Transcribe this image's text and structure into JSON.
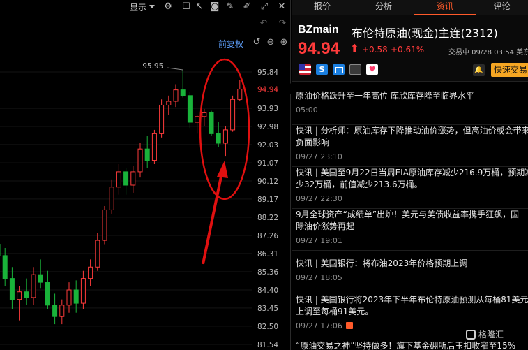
{
  "toolbar": {
    "display_label": "显示",
    "icons": [
      "settings-icon",
      "square-icon",
      "cursor-icon",
      "camera-icon",
      "brush-icon",
      "pencil-icon",
      "fullscreen-icon",
      "close-icon"
    ]
  },
  "chart": {
    "restore_label": "前复权",
    "current_price_label": "94.94",
    "high_annotation": "95.95"
  },
  "chart_data": {
    "type": "candlestick",
    "y_ticks": [
      "95.84",
      "94.94",
      "93.93",
      "92.98",
      "92.03",
      "91.07",
      "90.12",
      "89.17",
      "88.22",
      "87.26",
      "86.31",
      "85.36",
      "84.40",
      "83.45",
      "82.50",
      "81.54"
    ],
    "current_price": 94.94,
    "high_annotation": 95.95,
    "candles": [
      {
        "o": 86.8,
        "h": 87.6,
        "l": 86.0,
        "c": 86.2
      },
      {
        "o": 86.2,
        "h": 86.6,
        "l": 84.6,
        "c": 85.0
      },
      {
        "o": 85.0,
        "h": 85.6,
        "l": 83.4,
        "c": 83.9
      },
      {
        "o": 83.9,
        "h": 84.6,
        "l": 82.8,
        "c": 84.3
      },
      {
        "o": 84.3,
        "h": 85.0,
        "l": 83.6,
        "c": 84.0
      },
      {
        "o": 84.0,
        "h": 85.6,
        "l": 83.6,
        "c": 85.2
      },
      {
        "o": 85.2,
        "h": 86.0,
        "l": 84.5,
        "c": 84.8
      },
      {
        "o": 84.8,
        "h": 85.4,
        "l": 83.4,
        "c": 83.6
      },
      {
        "o": 83.6,
        "h": 84.2,
        "l": 82.6,
        "c": 83.0
      },
      {
        "o": 83.0,
        "h": 83.9,
        "l": 82.6,
        "c": 83.6
      },
      {
        "o": 83.6,
        "h": 84.8,
        "l": 83.2,
        "c": 84.4
      },
      {
        "o": 84.4,
        "h": 84.9,
        "l": 83.2,
        "c": 83.7
      },
      {
        "o": 83.7,
        "h": 85.4,
        "l": 83.4,
        "c": 85.0
      },
      {
        "o": 85.0,
        "h": 86.0,
        "l": 84.6,
        "c": 85.6
      },
      {
        "o": 85.6,
        "h": 87.4,
        "l": 85.4,
        "c": 87.0
      },
      {
        "o": 87.0,
        "h": 88.8,
        "l": 86.8,
        "c": 88.6
      },
      {
        "o": 88.6,
        "h": 90.2,
        "l": 88.4,
        "c": 89.8
      },
      {
        "o": 89.8,
        "h": 91.0,
        "l": 89.4,
        "c": 90.6
      },
      {
        "o": 90.6,
        "h": 90.8,
        "l": 89.4,
        "c": 89.9
      },
      {
        "o": 89.9,
        "h": 90.9,
        "l": 89.5,
        "c": 90.6
      },
      {
        "o": 90.6,
        "h": 92.1,
        "l": 90.3,
        "c": 91.8
      },
      {
        "o": 91.8,
        "h": 92.5,
        "l": 90.8,
        "c": 91.2
      },
      {
        "o": 91.2,
        "h": 92.8,
        "l": 91.0,
        "c": 92.6
      },
      {
        "o": 92.6,
        "h": 94.4,
        "l": 92.4,
        "c": 94.1
      },
      {
        "o": 94.1,
        "h": 94.6,
        "l": 93.6,
        "c": 94.3
      },
      {
        "o": 94.3,
        "h": 95.2,
        "l": 94.0,
        "c": 94.9
      },
      {
        "o": 94.9,
        "h": 95.95,
        "l": 94.5,
        "c": 94.6
      },
      {
        "o": 94.6,
        "h": 94.8,
        "l": 92.9,
        "c": 93.2
      },
      {
        "o": 93.2,
        "h": 93.6,
        "l": 92.6,
        "c": 93.5
      },
      {
        "o": 93.5,
        "h": 93.9,
        "l": 93.0,
        "c": 93.7
      },
      {
        "o": 93.7,
        "h": 93.8,
        "l": 92.5,
        "c": 92.6
      },
      {
        "o": 92.6,
        "h": 93.2,
        "l": 91.9,
        "c": 92.1
      },
      {
        "o": 92.1,
        "h": 93.0,
        "l": 91.4,
        "c": 92.8
      },
      {
        "o": 92.8,
        "h": 94.6,
        "l": 92.7,
        "c": 94.4
      },
      {
        "o": 94.4,
        "h": 95.4,
        "l": 94.3,
        "c": 94.94
      }
    ]
  },
  "tabs": [
    {
      "label": "报价",
      "active": false
    },
    {
      "label": "分析",
      "active": false
    },
    {
      "label": "资讯",
      "active": true
    },
    {
      "label": "评论",
      "active": false
    }
  ],
  "quote": {
    "symbol": "BZmain",
    "name": "布伦特原油(现金)主连(2312)",
    "price": "94.94",
    "change": "+0.58",
    "change_pct": "+0.61%",
    "trade_time": "交易中 09/28 03:54 美东",
    "quick_trade_label": "快速交易"
  },
  "news": [
    {
      "title": "原油价格跃升至一年高位 库欣库存降至临界水平",
      "time": "05:00",
      "tag": false
    },
    {
      "title": "快讯 | 分析师：原油库存下降推动油价涨势，但高油价或会带来\n负面影响",
      "time": "09/27 23:10",
      "tag": false
    },
    {
      "title": "快讯 | 美国至9月22日当周EIA原油库存减少216.9万桶，预期减\n少32万桶，前值减少213.6万桶。",
      "time": "09/27 22:30",
      "tag": false
    },
    {
      "title": "9月全球资产“成绩单”出炉！美元与美债收益率携手狂飙，国\n际油价涨势再起",
      "time": "09/27 19:01",
      "tag": false
    },
    {
      "title": "快讯 | 美国银行：将布油2023年价格预期上调",
      "time": "09/27 18:05",
      "tag": false
    },
    {
      "title": "快讯 | 美国银行将2023年下半年布伦特原油预测从每桶81美元\n上调至每桶91美元。",
      "time": "09/27 17:06",
      "tag": true
    },
    {
      "title": "“原油交易之神”坚持做多！旗下基金硼所后玉扣收窄至15%",
      "time": "",
      "tag": false
    }
  ],
  "watermark": "格隆汇",
  "colors": {
    "up": "#ff3b3b",
    "down": "#19b33a",
    "accent": "#ff5a2a",
    "quick_trade": "#f5a623",
    "link": "#5fa2ff"
  }
}
